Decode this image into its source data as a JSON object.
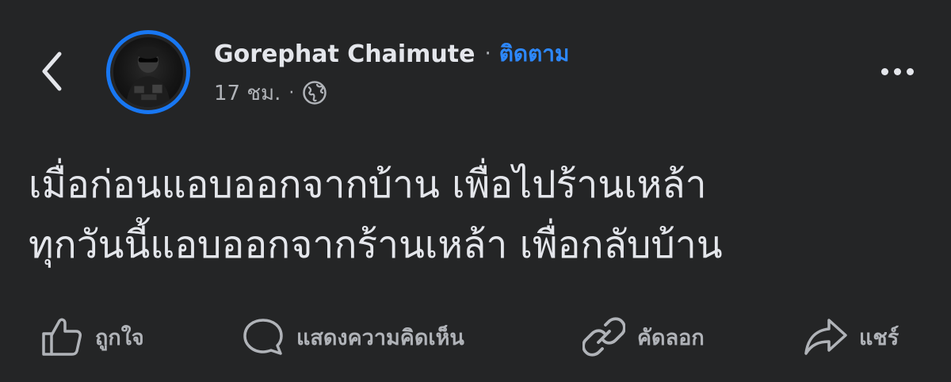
{
  "header": {
    "back_icon": "chevron-left-icon",
    "author": "Gorephat Chaimute",
    "separator": "·",
    "follow_label": "ติดตาม",
    "time": "17 ชม.",
    "meta_separator": "·",
    "privacy_icon": "globe-icon",
    "more_icon": "more-horizontal-icon"
  },
  "post": {
    "lines": [
      "เมื่อก่อนแอบออกจากบ้าน เพื่อไปร้านเหล้า",
      "ทุกวันนี้แอบออกจากร้านเหล้า เพื่อกลับบ้าน"
    ]
  },
  "actions": [
    {
      "icon": "thumbs-up-icon",
      "label": "ถูกใจ"
    },
    {
      "icon": "comment-icon",
      "label": "แสดงความคิดเห็น"
    },
    {
      "icon": "link-icon",
      "label": "คัดลอก"
    },
    {
      "icon": "share-icon",
      "label": "แชร์"
    }
  ],
  "colors": {
    "background": "#242526",
    "text_primary": "#e4e6eb",
    "text_secondary": "#b0b3b8",
    "accent": "#2d88ff",
    "avatar_ring": "#1877f2"
  }
}
